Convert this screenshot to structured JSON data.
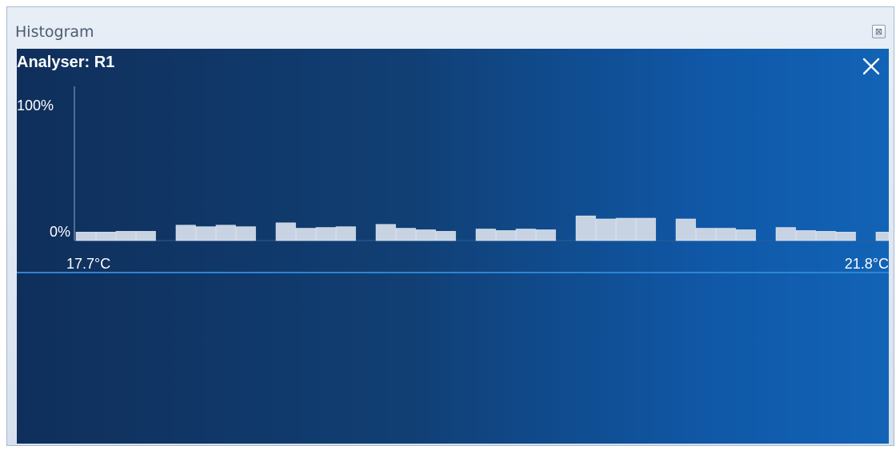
{
  "window": {
    "title": "Histogram",
    "close_glyph": "⊠"
  },
  "panel": {
    "analyser_label": "Analyser: R1",
    "close_icon": "close-icon"
  },
  "chart_data": {
    "type": "bar",
    "title": "",
    "xlabel": "",
    "ylabel": "",
    "ylim": [
      0,
      100
    ],
    "y_tick_labels": [
      "100%",
      "0%"
    ],
    "x_tick_labels": [
      "17.7°C",
      "21.8°C"
    ],
    "x_range": [
      17.7,
      21.8
    ],
    "grid": false,
    "bar_color": "#c7d3e2",
    "values": [
      5.5,
      5.5,
      6,
      6,
      null,
      10,
      9,
      10,
      9,
      null,
      11.5,
      8,
      8.5,
      9,
      null,
      10.5,
      8,
      7,
      6,
      null,
      7.5,
      6.5,
      7.5,
      7,
      null,
      16,
      14,
      14.5,
      14.5,
      null,
      14,
      8,
      8,
      7,
      null,
      8.5,
      6.5,
      6,
      5.5,
      null,
      5.5
    ]
  }
}
